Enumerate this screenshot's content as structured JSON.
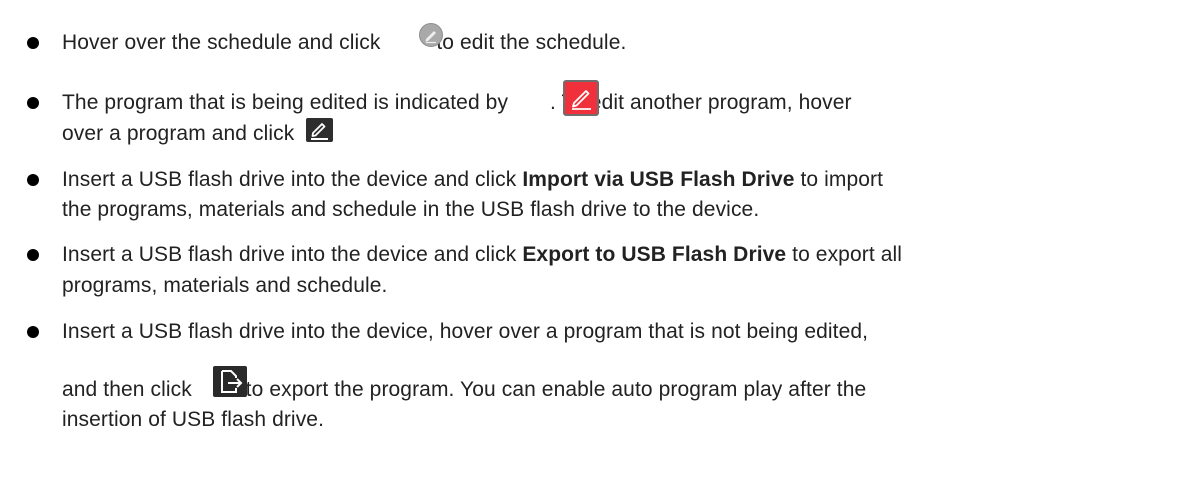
{
  "bullets": [
    {
      "line1_pre": "Hover over the schedule and click ",
      "line1_post": " to edit the schedule.",
      "icon": "pencil-gray-circle-icon"
    },
    {
      "line1_pre": "The program that is being edited is indicated by ",
      "line1_post": ". To edit another program, hover",
      "line2_pre": "over a program and click ",
      "line2_post": ".",
      "icon_1": "pencil-red-square-icon",
      "icon_2": "pencil-dark-square-icon"
    },
    {
      "line1_pre": "Insert a USB flash drive into the device and click ",
      "line1_bold": "Import via USB Flash Drive",
      "line1_post": " to import",
      "line2": "the programs, materials and schedule in the USB flash drive to the device."
    },
    {
      "line1_pre": "Insert a USB flash drive into the device and click ",
      "line1_bold": "Export to USB Flash Drive",
      "line1_post": " to export all",
      "line2": "programs, materials and schedule."
    },
    {
      "line1": "Insert a USB flash drive into the device, hover over a program that is not being edited,",
      "line2_pre": "and then click ",
      "line2_post": " to export the program. You can enable auto program play after the",
      "line3": "insertion of USB flash drive.",
      "icon": "export-icon"
    }
  ],
  "colors": {
    "text": "#222222",
    "bullet": "#000000",
    "red_icon": "#f0303a",
    "gray_icon": "#a9a9a9",
    "dark_icon": "#2e2e2e"
  }
}
